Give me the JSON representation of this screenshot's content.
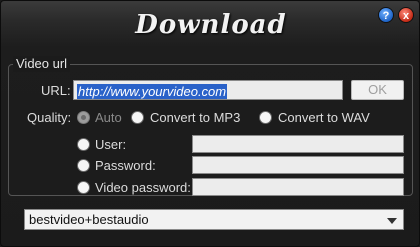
{
  "window": {
    "title": "Download",
    "help_icon": "question-mark-icon",
    "close_icon": "close-x-icon",
    "help_glyph": "?",
    "close_glyph": "x"
  },
  "video_url_group": {
    "label": "Video url",
    "url": {
      "label": "URL:",
      "value": "http://www.yourvideo.com"
    },
    "ok_label": "OK",
    "quality": {
      "label": "Quality:",
      "options": [
        {
          "label": "Auto",
          "enabled": false
        },
        {
          "label": "Convert to MP3",
          "enabled": true
        },
        {
          "label": "Convert to WAV",
          "enabled": true
        }
      ]
    },
    "credentials": {
      "user_label": "User:",
      "password_label": "Password:",
      "video_password_label": "Video password:"
    }
  },
  "format_select": {
    "value": "bestvideo+bestaudio"
  },
  "colors": {
    "window_bg": "#1b1b1b",
    "selection": "#2a62c9",
    "help_button": "#1e63c6",
    "close_button": "#c22a16"
  }
}
